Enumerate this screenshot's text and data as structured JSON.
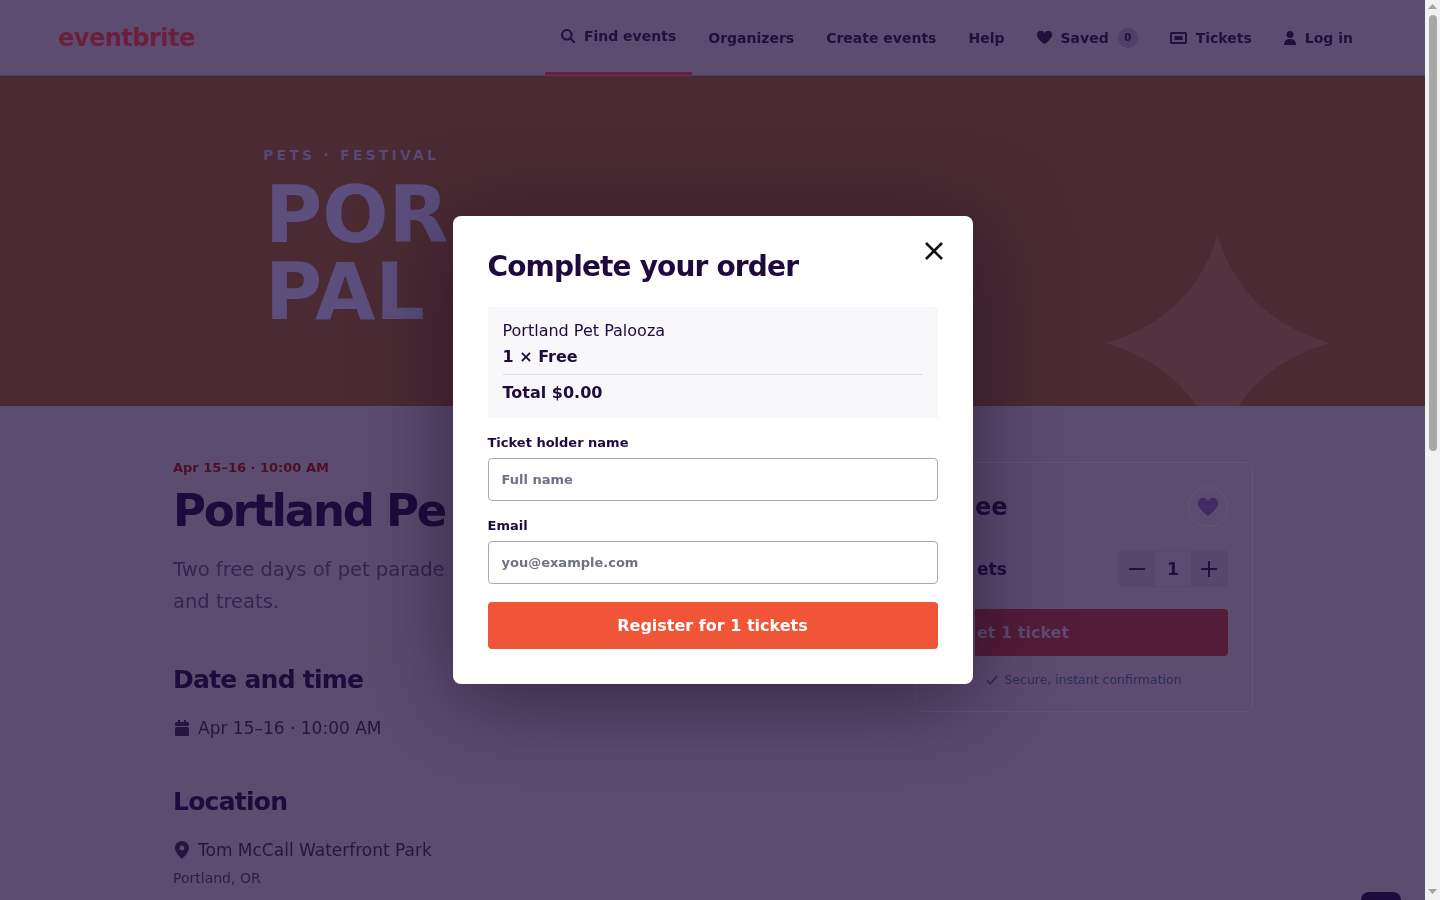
{
  "header": {
    "logo": "eventbrite",
    "nav": [
      {
        "label": "Find events",
        "selected": true
      },
      {
        "label": "Organizers",
        "selected": false
      },
      {
        "label": "Create events",
        "selected": false
      },
      {
        "label": "Help",
        "selected": false
      },
      {
        "label": "Saved",
        "badge": "0",
        "selected": false
      },
      {
        "label": "Tickets",
        "selected": false
      },
      {
        "label": "Log in",
        "selected": false
      }
    ]
  },
  "hero": {
    "eyebrow": "PETS · FESTIVAL",
    "title_lines": [
      "POR",
      "PAL"
    ]
  },
  "event": {
    "date": "Apr 15–16 · 10:00 AM",
    "title": "Portland Pe",
    "description_lines": [
      "Two free days of pet parade",
      "and treats."
    ],
    "sections": [
      {
        "heading": "Date and time",
        "items": [
          {
            "text": "Apr 15–16 · 10:00 AM"
          }
        ]
      },
      {
        "heading": "Location",
        "items": [
          {
            "text": "Tom McCall Waterfront Park",
            "sub": "Portland, OR"
          }
        ]
      }
    ]
  },
  "ticket_card": {
    "price": "ee",
    "quantity_label": "ets",
    "quantity": "1",
    "button": "et 1 ticket",
    "note": "Secure, instant confirmation"
  },
  "modal": {
    "title": "Complete your order",
    "summary": {
      "event": "Portland Pet Palooza",
      "line": "1 × Free",
      "total": "Total $0.00"
    },
    "fields": [
      {
        "label": "Ticket holder name",
        "placeholder": "Full name"
      },
      {
        "label": "Email",
        "placeholder": "you@example.com"
      }
    ],
    "button": "Register for 1 tickets"
  }
}
